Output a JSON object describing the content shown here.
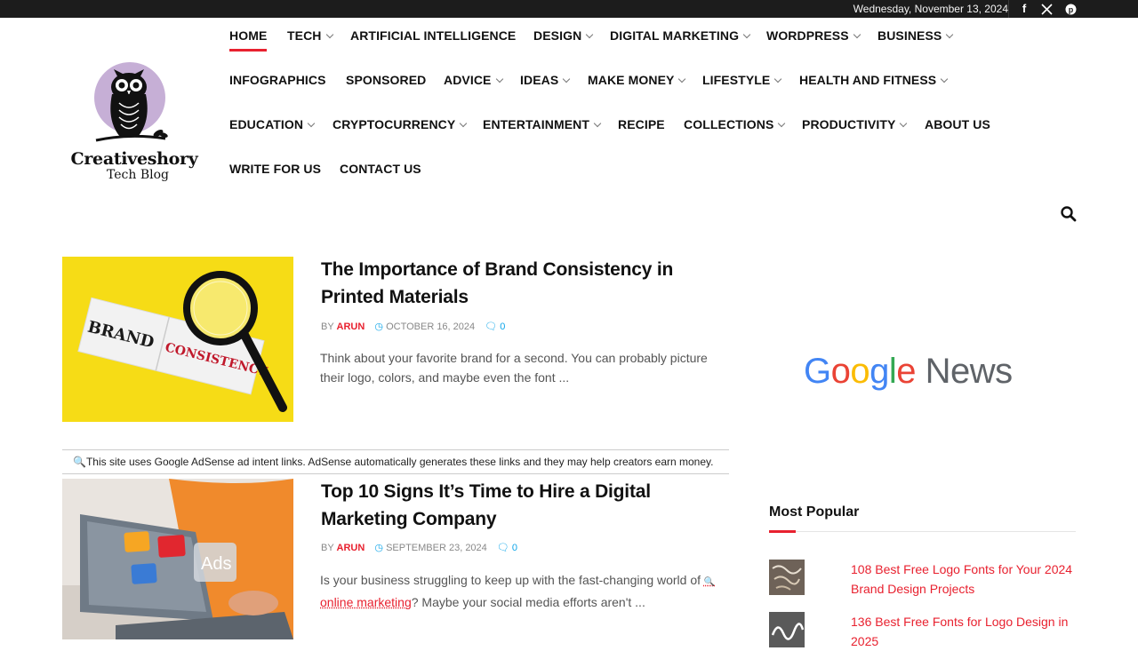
{
  "topbar": {
    "date": "Wednesday, November 13, 2024",
    "social": [
      {
        "name": "facebook-icon",
        "glyph": "f"
      },
      {
        "name": "x-icon",
        "glyph": "X"
      },
      {
        "name": "pinterest-icon",
        "glyph": "P"
      }
    ]
  },
  "logo": {
    "name": "Creativeshory",
    "tagline": "Tech Blog"
  },
  "nav": {
    "items": [
      {
        "label": "HOME",
        "dropdown": false,
        "active": true
      },
      {
        "label": "TECH",
        "dropdown": true
      },
      {
        "label": "ARTIFICIAL INTELLIGENCE",
        "dropdown": false
      },
      {
        "label": "DESIGN",
        "dropdown": true
      },
      {
        "label": "DIGITAL MARKETING",
        "dropdown": true
      },
      {
        "label": "WORDPRESS",
        "dropdown": true
      },
      {
        "label": "BUSINESS",
        "dropdown": true
      },
      {
        "label": "INFOGRAPHICS",
        "dropdown": false
      },
      {
        "label": "SPONSORED",
        "dropdown": false
      },
      {
        "label": "ADVICE",
        "dropdown": true
      },
      {
        "label": "IDEAS",
        "dropdown": true
      },
      {
        "label": "MAKE MONEY",
        "dropdown": true
      },
      {
        "label": "LIFESTYLE",
        "dropdown": true
      },
      {
        "label": "HEALTH AND FITNESS",
        "dropdown": true
      },
      {
        "label": "EDUCATION",
        "dropdown": true
      },
      {
        "label": "CRYPTOCURRENCY",
        "dropdown": true
      },
      {
        "label": "ENTERTAINMENT",
        "dropdown": true
      },
      {
        "label": "RECIPE",
        "dropdown": false
      },
      {
        "label": "COLLECTIONS",
        "dropdown": true
      },
      {
        "label": "PRODUCTIVITY",
        "dropdown": true
      },
      {
        "label": "ABOUT US",
        "dropdown": false
      },
      {
        "label": "WRITE FOR US",
        "dropdown": false
      },
      {
        "label": "CONTACT US",
        "dropdown": false
      }
    ]
  },
  "articles": [
    {
      "title": "The Importance of Brand Consistency in Printed Materials",
      "by": "BY",
      "author": "ARUN",
      "date": "OCTOBER 16, 2024",
      "comments": "0",
      "excerpt": "Think about your favorite brand for a second. You can probably picture their logo, colors, and maybe even the font ...",
      "thumb_text_1": "BRAND",
      "thumb_text_2": "CONSISTENCY"
    },
    {
      "title": "Top 10 Signs It’s Time to Hire a Digital Marketing Company",
      "by": "BY",
      "author": "ARUN",
      "date": "SEPTEMBER 23, 2024",
      "comments": "0",
      "excerpt_before": "Is your business struggling to keep up with the fast-changing world of",
      "excerpt_link": "online marketing",
      "excerpt_after": "? Maybe your social media efforts aren't ...",
      "thumb_text": "Ads"
    }
  ],
  "adsense_notice": "This site uses Google AdSense ad intent links. AdSense automatically generates these links and they may help creators earn money.",
  "sidebar": {
    "google_news": {
      "google": "Google",
      "news": "News"
    },
    "popular_title": "Most Popular",
    "popular": [
      {
        "title": "108 Best Free Logo Fonts for Your 2024 Brand Design Projects"
      },
      {
        "title": "136 Best Free Fonts for Logo Design in 2025"
      }
    ]
  },
  "colors": {
    "accent": "#e8212f",
    "topbar": "#1c1c1c",
    "meta_blue": "#0ea5e9"
  }
}
